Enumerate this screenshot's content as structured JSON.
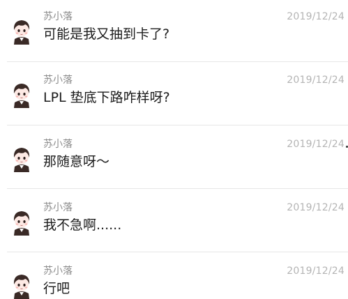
{
  "messages": [
    {
      "sender": "苏小落",
      "date": "2019/12/24",
      "text": "可能是我又抽到卡了?"
    },
    {
      "sender": "苏小落",
      "date": "2019/12/24",
      "text": "LPL 垫底下路咋样呀?"
    },
    {
      "sender": "苏小落",
      "date": "2019/12/24",
      "text": "那随意呀～"
    },
    {
      "sender": "苏小落",
      "date": "2019/12/24",
      "text": "我不急啊......"
    },
    {
      "sender": "苏小落",
      "date": "2019/12/24",
      "text": "行吧"
    }
  ],
  "colors": {
    "name": "#8d8d8d",
    "date": "#b4b4b4",
    "text": "#1b1b1b",
    "divider": "#e6e6e6",
    "hair": "#3a2a26",
    "skin": "#fde9e4"
  },
  "avatar_icon": "chibi-boy-avatar-icon"
}
